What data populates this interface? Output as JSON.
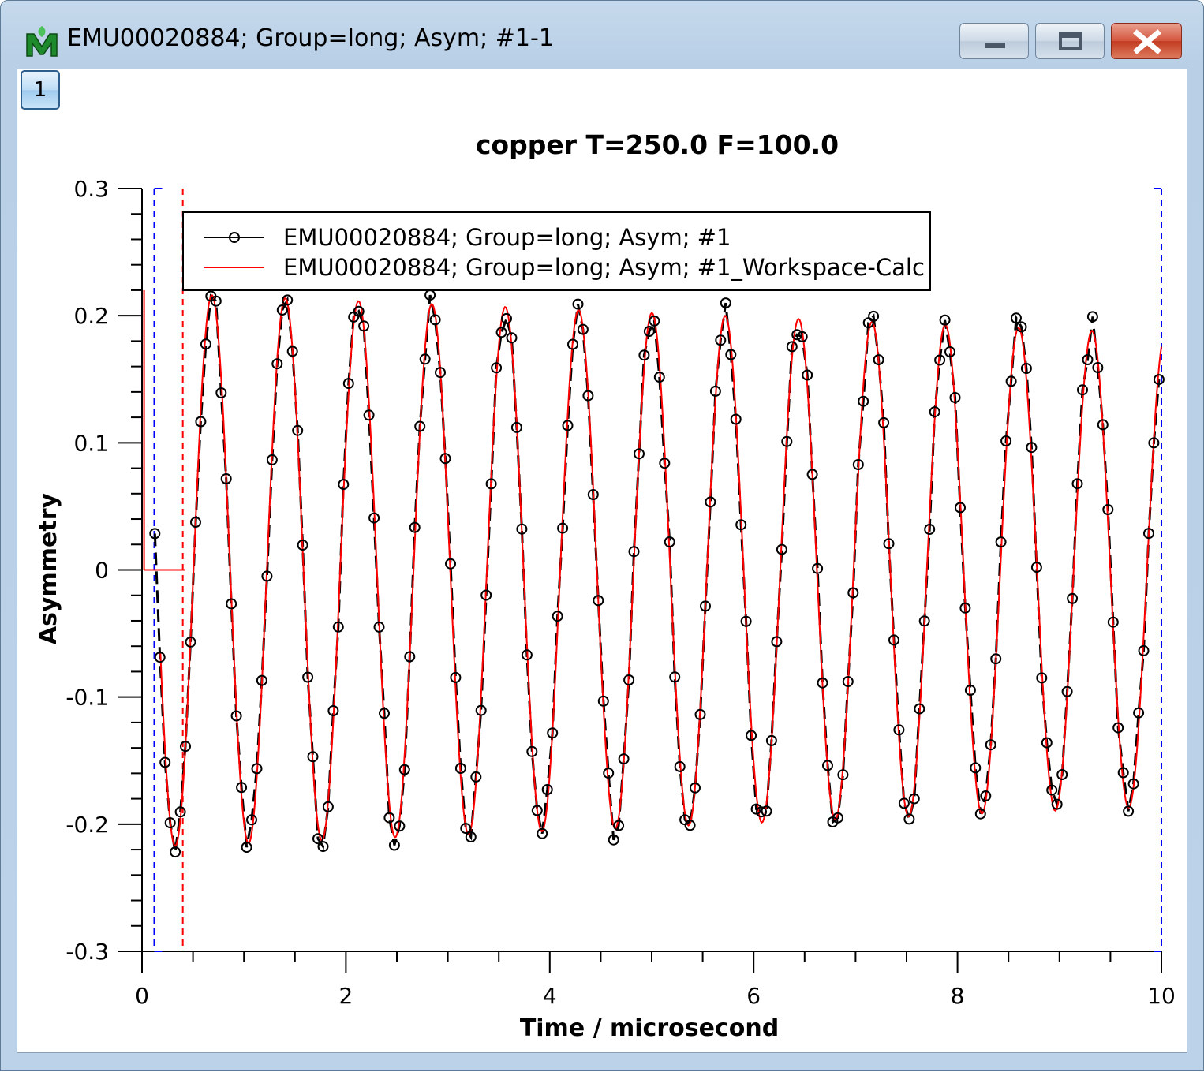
{
  "window": {
    "title": "EMU00020884; Group=long; Asym; #1-1",
    "layer_label": "1",
    "app_icon": "mantid-icon",
    "controls": [
      "minimize-icon",
      "maximize-icon",
      "close-icon"
    ]
  },
  "colors": {
    "data_series": "#000000",
    "calc_series": "#ff0000",
    "fit_range_marker": "#0000ff",
    "peak_marker": "#ff0000"
  },
  "chart_data": {
    "type": "line",
    "title": "copper T=250.0 F=100.0",
    "xlabel": "Time / microsecond",
    "ylabel": "Asymmetry",
    "xlim": [
      0,
      10
    ],
    "ylim": [
      -0.3,
      0.3
    ],
    "x_ticks": [
      0,
      2,
      4,
      6,
      8,
      10
    ],
    "x_tick_labels": [
      "0",
      "2",
      "4",
      "6",
      "8",
      "10"
    ],
    "y_ticks": [
      -0.3,
      -0.2,
      -0.1,
      0,
      0.1,
      0.2,
      0.3
    ],
    "y_tick_labels": [
      "-0.3",
      "-0.2",
      "-0.1",
      "0",
      "0.1",
      "0.2",
      "0.3"
    ],
    "grid": false,
    "legend_position": "top",
    "oscillation": {
      "start_time": 0.12,
      "period": 0.7195,
      "first_peak_time": 0.685,
      "start_amplitude": 0.218,
      "end_amplitude": 0.186,
      "offset": 0.0,
      "sample_spacing": 0.05
    },
    "series": [
      {
        "name": "EMU00020884; Group=long; Asym; #1",
        "style": "dashed line with open circles",
        "color": "#000000",
        "noise": 0.012
      },
      {
        "name": "EMU00020884; Group=long; Asym; #1_Workspace-Calc",
        "style": "solid line",
        "color": "#ff0000"
      }
    ],
    "markers": {
      "fit_range": {
        "start": 0.12,
        "end": 10.0,
        "color": "#0000ff",
        "style": "dashed"
      },
      "peak_line": {
        "x": 0.4,
        "color": "#ff0000",
        "style": "dashed"
      },
      "peak_marker": {
        "x": 0.02,
        "height": 0.22,
        "width": 0.4,
        "color": "#ff0000"
      }
    }
  }
}
